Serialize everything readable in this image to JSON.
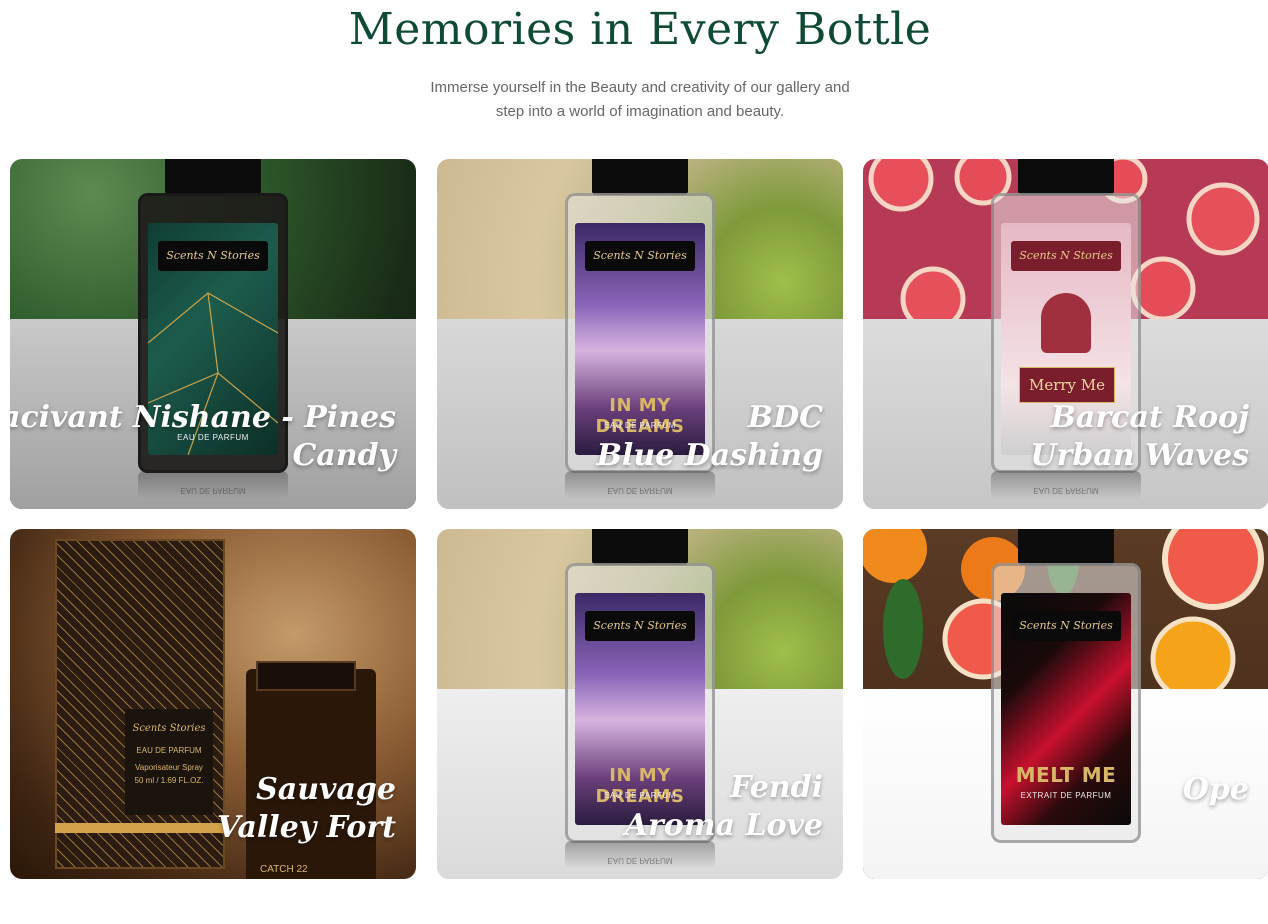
{
  "page": {
    "heading": "Memories in Every Bottle",
    "subtitle_line1": "Immerse yourself in the Beauty and creativity of our gallery and",
    "subtitle_line2": "step into a world of imagination and beauty."
  },
  "gallery": [
    {
      "title_line1": "Hacivant Nishane - Pines",
      "title_line2": "Candy",
      "brand": "Scents N Stories",
      "product_name": "",
      "product_type": "EAU DE PARFUM",
      "reflection": "EAU DE PARFUM"
    },
    {
      "title_line1": "BDC",
      "title_line2": "Blue Dashing",
      "brand": "Scents N Stories",
      "product_name": "IN MY DREAMS",
      "product_type": "EAU DE PARFUM",
      "reflection": "EAU DE PARFUM"
    },
    {
      "title_line1": "Barcat Rooj",
      "title_line2": "Urban Waves",
      "brand": "Scents N Stories",
      "product_name": "Merry Me",
      "product_type": "",
      "reflection": "EAU DE PARFUM"
    },
    {
      "title_line1": "Sauvage",
      "title_line2": "Valley Fort",
      "brand": "Scents Stories",
      "box_type": "EAU DE PARFUM",
      "box_spray": "Vaporisateur Spray",
      "box_size": "50 ml / 1.69 FL.OZ.",
      "product_name": "CATCH 22"
    },
    {
      "title_line1": "Fendi",
      "title_line2": "Aroma Love",
      "brand": "Scents N Stories",
      "product_name": "IN MY DREAMS",
      "product_type": "EAU DE PARFUM",
      "reflection": "EAU DE PARFUM"
    },
    {
      "title_line1": "",
      "title_line2": "Ope",
      "brand": "Scents N Stories",
      "product_name": "MELT ME",
      "product_type": "EXTRAIT DE PARFUM"
    }
  ],
  "colors": {
    "heading": "#0f4a33",
    "subtitle": "#666666",
    "gold": "#d8b766"
  }
}
